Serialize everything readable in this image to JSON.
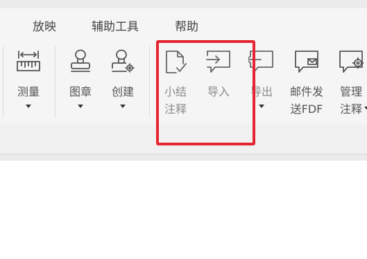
{
  "menu": {
    "items": [
      {
        "label": "放映"
      },
      {
        "label": "辅助工具"
      },
      {
        "label": "帮助"
      }
    ]
  },
  "ribbon": {
    "tools": [
      {
        "line1": "测量",
        "line2": "",
        "icon": "ruler-icon",
        "dropdown": true
      },
      {
        "line1": "图章",
        "line2": "",
        "icon": "stamp-icon",
        "dropdown": true
      },
      {
        "line1": "创建",
        "line2": "",
        "icon": "create-stamp-icon",
        "dropdown": true
      },
      {
        "line1": "小结",
        "line2": "注释",
        "icon": "summarize-comments-icon",
        "dropdown": false
      },
      {
        "line1": "导入",
        "line2": "",
        "icon": "import-comments-icon",
        "dropdown": false
      },
      {
        "line1": "导出",
        "line2": "",
        "icon": "export-comments-icon",
        "dropdown": true
      },
      {
        "line1": "邮件发",
        "line2": "送FDF",
        "icon": "email-fdf-icon",
        "dropdown": false
      },
      {
        "line1": "管理",
        "line2": "注释",
        "icon": "manage-comments-icon",
        "dropdown": true
      }
    ]
  },
  "colors": {
    "highlight": "#e5252f",
    "icon_stroke": "#555555",
    "ribbon_bg": "#f5f5f5"
  }
}
